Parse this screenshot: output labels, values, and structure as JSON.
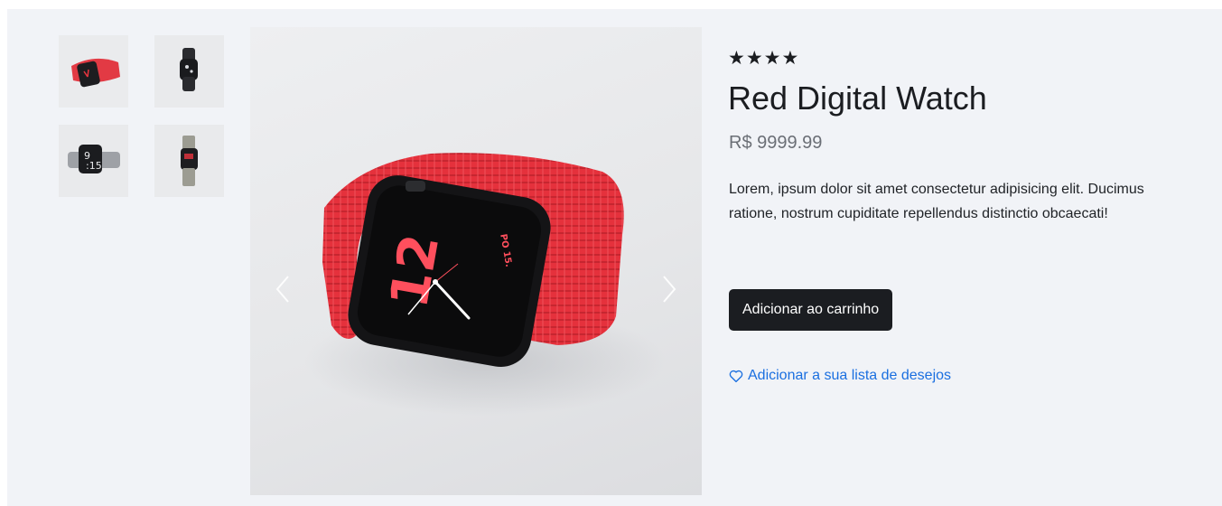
{
  "product": {
    "rating_stars": "★★★★",
    "rating": 4,
    "title": "Red Digital Watch",
    "price": "R$ 9999.99",
    "description": "Lorem, ipsum dolor sit amet consectetur adipisicing elit. Ducimus ratione, nostrum cupiditate repellendus distinctio obcaecati!"
  },
  "gallery": {
    "thumbnails": [
      {
        "icon": "red-watch-thumbnail"
      },
      {
        "icon": "black-watch-thumbnail"
      },
      {
        "icon": "gray-watch-thumbnail"
      },
      {
        "icon": "steel-band-watch-thumbnail"
      }
    ],
    "main_image": {
      "icon": "red-watch-photo",
      "dial_text": "12",
      "date_text": "PO 15."
    }
  },
  "actions": {
    "add_to_cart_label": "Adicionar ao carrinho",
    "wishlist_label": "Adicionar a sua lista de desejos"
  },
  "colors": {
    "button_bg": "#1b1d21",
    "link": "#1a6fe0",
    "band": "#e8353f",
    "panel_bg": "#f1f3f7"
  }
}
